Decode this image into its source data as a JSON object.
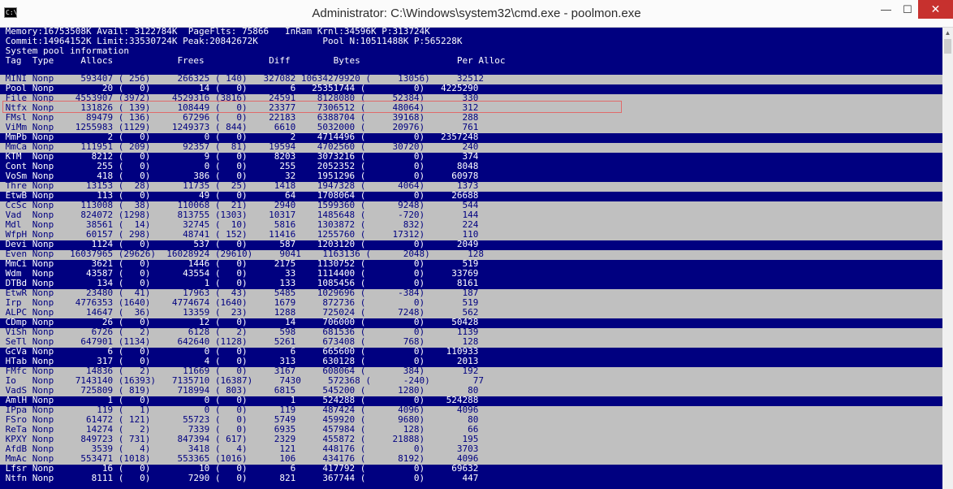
{
  "window": {
    "title": "Administrator: C:\\Windows\\system32\\cmd.exe - poolmon.exe",
    "icon_label": "C:\\",
    "minimize_glyph": "—",
    "maximize_glyph": "☐",
    "close_glyph": "✕"
  },
  "colors": {
    "console_background": "#000080",
    "gray_row": "#c0c0c0",
    "gray_row_text": "#000080",
    "blue_row_text": "#ffffff",
    "highlight_border": "#e06a6a",
    "close_button": "#c7312e"
  },
  "scrollbar": {
    "up_arrow_glyph": "▲"
  },
  "header_lines": [
    " Memory:16753508K Avail: 3122784K  PageFlts: 75866   InRam Krnl:34596K P:313724K",
    " Commit:14964152K Limit:33530724K Peak:20842672K            Pool N:10511488K P:565228K",
    " System pool information",
    " Tag  Type     Allocs            Frees            Diff        Bytes                  Per Alloc"
  ],
  "highlighted_row": "MINI",
  "rows": [
    {
      "tag": "MINI",
      "bg": "gray",
      "text": " MINI Nonp     593407 ( 256)     266325 ( 140)   327082 10634279920 (     13056)     32512"
    },
    {
      "tag": "Pool",
      "bg": "blue",
      "text": " Pool Nonp         20 (   0)         14 (   0)        6   25351744 (         0)   4225290"
    },
    {
      "tag": "File",
      "bg": "gray",
      "text": " File Nonp    4553907 (3972)    4529316 (3816)    24591    8128080 (     52384)       330"
    },
    {
      "tag": "Ntfx",
      "bg": "gray",
      "text": " Ntfx Nonp     131826 ( 139)     108449 (   0)    23377    7306512 (     48064)       312"
    },
    {
      "tag": "FMsl",
      "bg": "gray",
      "text": " FMsl Nonp      89479 ( 136)      67296 (   0)    22183    6388704 (     39168)       288"
    },
    {
      "tag": "ViMm",
      "bg": "gray",
      "text": " ViMm Nonp    1255983 (1129)    1249373 ( 844)     6610    5032000 (     20976)       761"
    },
    {
      "tag": "MmPb",
      "bg": "blue",
      "text": " MmPb Nonp          2 (   0)          0 (   0)        2    4714496 (         0)   2357248"
    },
    {
      "tag": "MmCa",
      "bg": "gray",
      "text": " MmCa Nonp     111951 ( 209)      92357 (  81)    19594    4702560 (     30720)       240"
    },
    {
      "tag": "KTM",
      "bg": "blue",
      "text": " KTM  Nonp       8212 (   0)          9 (   0)     8203    3073216 (         0)       374"
    },
    {
      "tag": "Cont",
      "bg": "blue",
      "text": " Cont Nonp        255 (   0)          0 (   0)      255    2052352 (         0)      8048"
    },
    {
      "tag": "VoSm",
      "bg": "blue",
      "text": " VoSm Nonp        418 (   0)        386 (   0)       32    1951296 (         0)     60978"
    },
    {
      "tag": "Thre",
      "bg": "gray",
      "text": " Thre Nonp      13153 (  28)      11735 (  25)     1418    1947328 (      4064)      1373"
    },
    {
      "tag": "EtwB",
      "bg": "blue",
      "text": " EtwB Nonp        113 (   0)         49 (   0)       64    1708064 (         0)     26688"
    },
    {
      "tag": "CcSc",
      "bg": "gray",
      "text": " CcSc Nonp     113008 (  38)     110068 (  21)     2940    1599360 (      9248)       544"
    },
    {
      "tag": "Vad",
      "bg": "gray",
      "text": " Vad  Nonp     824072 (1298)     813755 (1303)    10317    1485648 (      -720)       144"
    },
    {
      "tag": "Mdl",
      "bg": "gray",
      "text": " Mdl  Nonp      38561 (  14)      32745 (  10)     5816    1303872 (       832)       224"
    },
    {
      "tag": "WfpH",
      "bg": "gray",
      "text": " WfpH Nonp      60157 ( 298)      48741 ( 152)    11416    1255760 (     17312)       110"
    },
    {
      "tag": "Devi",
      "bg": "blue",
      "text": " Devi Nonp       1124 (   0)        537 (   0)      587    1203120 (         0)      2049"
    },
    {
      "tag": "Even",
      "bg": "gray",
      "text": " Even Nonp   16037965 (29626)  16028924 (29610)     9041    1163136 (      2048)       128"
    },
    {
      "tag": "MmCi",
      "bg": "blue",
      "text": " MmCi Nonp       3621 (   0)       1446 (   0)     2175    1130752 (         0)       519"
    },
    {
      "tag": "Wdm",
      "bg": "blue",
      "text": " Wdm  Nonp      43587 (   0)      43554 (   0)       33    1114400 (         0)     33769"
    },
    {
      "tag": "DTBd",
      "bg": "blue",
      "text": " DTBd Nonp        134 (   0)          1 (   0)      133    1085456 (         0)      8161"
    },
    {
      "tag": "EtwR",
      "bg": "gray",
      "text": " EtwR Nonp      23480 (  41)      17963 (  43)     5485    1029696 (      -384)       187"
    },
    {
      "tag": "Irp",
      "bg": "gray",
      "text": " Irp  Nonp    4776353 (1640)    4774674 (1640)     1679     872736 (         0)       519"
    },
    {
      "tag": "ALPC",
      "bg": "gray",
      "text": " ALPC Nonp      14647 (  36)      13359 (  23)     1288     725024 (      7248)       562"
    },
    {
      "tag": "CDmp",
      "bg": "blue",
      "text": " CDmp Nonp         26 (   0)         12 (   0)       14     706000 (         0)     50428"
    },
    {
      "tag": "ViSh",
      "bg": "gray",
      "text": " ViSh Nonp       6726 (   2)       6128 (   2)      598     681536 (         0)      1139"
    },
    {
      "tag": "SeTl",
      "bg": "gray",
      "text": " SeTl Nonp     647901 (1134)     642640 (1128)     5261     673408 (       768)       128"
    },
    {
      "tag": "GcVa",
      "bg": "blue",
      "text": " GcVa Nonp          6 (   0)          0 (   0)        6     665600 (         0)    110933"
    },
    {
      "tag": "HTab",
      "bg": "blue",
      "text": " HTab Nonp        317 (   0)          4 (   0)      313     630128 (         0)      2013"
    },
    {
      "tag": "FMfc",
      "bg": "gray",
      "text": " FMfc Nonp      14836 (   2)      11669 (   0)     3167     608064 (       384)       192"
    },
    {
      "tag": "Io",
      "bg": "gray",
      "text": " Io   Nonp    7143140 (16393)   7135710 (16387)     7430     572368 (      -240)        77"
    },
    {
      "tag": "VadS",
      "bg": "gray",
      "text": " VadS Nonp     725809 ( 819)     718994 ( 803)     6815     545200 (      1280)        80"
    },
    {
      "tag": "AmlH",
      "bg": "blue",
      "text": " AmlH Nonp          1 (   0)          0 (   0)        1     524288 (         0)    524288"
    },
    {
      "tag": "IPpa",
      "bg": "gray",
      "text": " IPpa Nonp        119 (   1)          0 (   0)      119     487424 (      4096)      4096"
    },
    {
      "tag": "FSro",
      "bg": "gray",
      "text": " FSro Nonp      61472 ( 121)      55723 (   0)     5749     459920 (      9680)        80"
    },
    {
      "tag": "ReTa",
      "bg": "gray",
      "text": " ReTa Nonp      14274 (   2)       7339 (   0)     6935     457984 (       128)        66"
    },
    {
      "tag": "KPXY",
      "bg": "gray",
      "text": " KPXY Nonp     849723 ( 731)     847394 ( 617)     2329     455872 (     21888)       195"
    },
    {
      "tag": "AfdB",
      "bg": "gray",
      "text": " AfdB Nonp       3539 (   4)       3418 (   4)      121     448176 (         0)      3703"
    },
    {
      "tag": "MmAc",
      "bg": "gray",
      "text": " MmAc Nonp     553471 (1018)     553365 (1016)      106     434176 (      8192)      4096"
    },
    {
      "tag": "Lfsr",
      "bg": "blue",
      "text": " Lfsr Nonp         16 (   0)         10 (   0)        6     417792 (         0)     69632"
    },
    {
      "tag": "Ntfn",
      "bg": "blue",
      "text": " Ntfn Nonp       8111 (   0)       7290 (   0)      821     367744 (         0)       447"
    }
  ]
}
